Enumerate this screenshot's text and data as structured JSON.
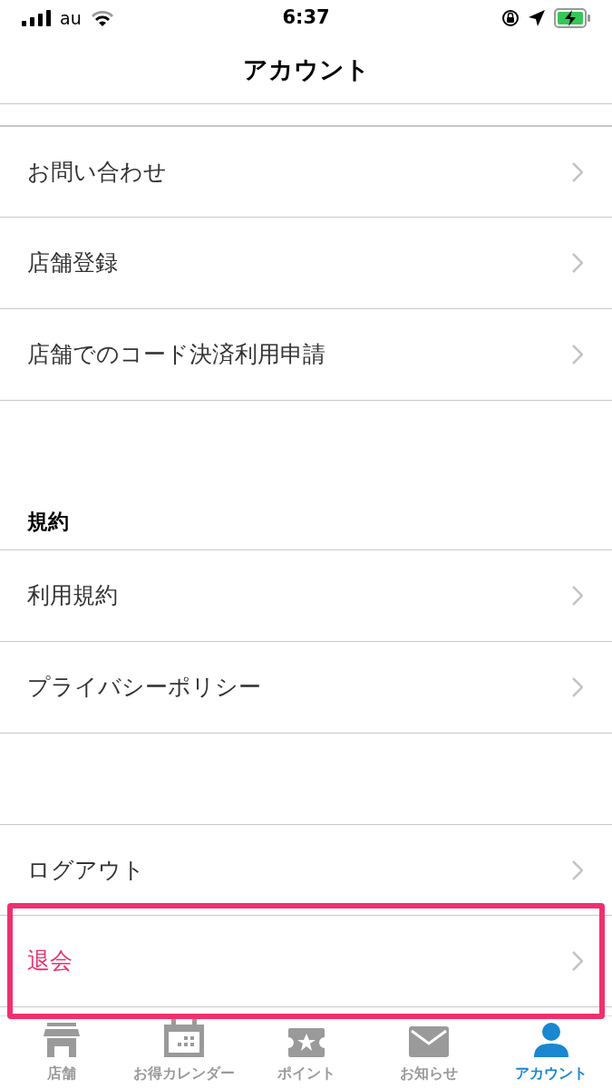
{
  "status_bar": {
    "carrier": "au",
    "time": "6:37"
  },
  "nav": {
    "title": "アカウント"
  },
  "sections": [
    {
      "items": [
        {
          "label": "お問い合わせ",
          "kind": "normal",
          "highlighted": false
        },
        {
          "label": "店舗登録",
          "kind": "normal",
          "highlighted": false
        },
        {
          "label": "店舗でのコード決済利用申請",
          "kind": "normal",
          "highlighted": false
        }
      ]
    },
    {
      "header": "規約",
      "items": [
        {
          "label": "利用規約",
          "kind": "normal",
          "highlighted": false
        },
        {
          "label": "プライバシーポリシー",
          "kind": "normal",
          "highlighted": false
        }
      ]
    },
    {
      "items": [
        {
          "label": "ログアウト",
          "kind": "normal",
          "highlighted": false
        },
        {
          "label": "退会",
          "kind": "danger",
          "highlighted": true
        }
      ]
    }
  ],
  "tab_bar": [
    {
      "label": "店舗",
      "kind": "store",
      "selected": false
    },
    {
      "label": "お得カレンダー",
      "kind": "calendar",
      "selected": false
    },
    {
      "label": "ポイント",
      "kind": "ticket",
      "selected": false
    },
    {
      "label": "お知らせ",
      "kind": "mail",
      "selected": false
    },
    {
      "label": "アカウント",
      "kind": "person",
      "selected": true
    }
  ]
}
